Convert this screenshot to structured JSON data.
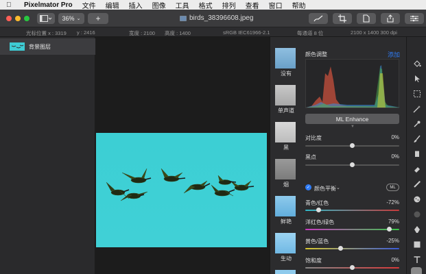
{
  "menubar": {
    "app": "Pixelmator Pro",
    "items": [
      "文件",
      "编辑",
      "插入",
      "图像",
      "工具",
      "格式",
      "排列",
      "查看",
      "窗口",
      "帮助"
    ]
  },
  "toolbar": {
    "zoom": "36%",
    "doc_title": "birds_38396608.jpeg"
  },
  "infobar": {
    "cursor_x": "光标位置 x : 3319",
    "cursor_y": "y : 2416",
    "width": "宽度 : 2100",
    "height": "高度 : 1400",
    "profile": "sRGB IEC61966-2.1",
    "depth": "每通道 8 位",
    "dims": "2100 x 1400 300 dpi"
  },
  "layers": [
    {
      "name": "背景图层"
    }
  ],
  "presets": [
    {
      "label": "没有"
    },
    {
      "label": "单声道"
    },
    {
      "label": "黑"
    },
    {
      "label": "烟"
    },
    {
      "label": "鲜艳"
    },
    {
      "label": "生动"
    }
  ],
  "adjust": {
    "title": "颜色调整",
    "add": "添加",
    "ml_enhance": "ML Enhance",
    "contrast": {
      "label": "对比度",
      "value": "0%",
      "level": 0.5
    },
    "blackpoint": {
      "label": "黑点",
      "value": "0%",
      "level": 0.5
    },
    "balance_title": "颜色平衡",
    "ml_badge": "ML",
    "cyan_red": {
      "label": "青色/红色",
      "value": "-72%",
      "level": 0.14
    },
    "magenta_green": {
      "label": "洋红色/绿色",
      "value": "79%",
      "level": 0.895
    },
    "yellow_blue": {
      "label": "黄色/蓝色",
      "value": "-25%",
      "level": 0.375
    },
    "saturation": {
      "label": "饱和度",
      "value": "0%",
      "level": 0.5
    }
  },
  "colors": {
    "accent": "#2f7cf6",
    "photo_sky": "#3ecbd3",
    "panel": "#2c2c2e"
  }
}
